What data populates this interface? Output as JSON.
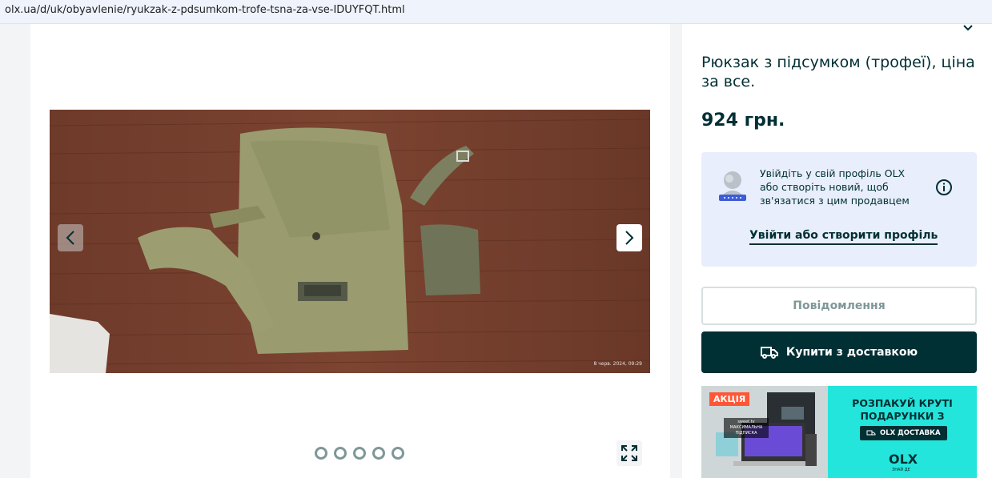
{
  "browser": {
    "url": "olx.ua/d/uk/obyavlenie/ryukzak-z-pdsumkom-trofe-tsna-za-vse-IDUYFQT.html"
  },
  "gallery": {
    "photo_caption_stamp": "8 черв. 2024, 09:29",
    "slide_count": 5,
    "icons": {
      "prev": "chevron-left-icon",
      "next": "chevron-right-icon",
      "fullscreen": "expand-icon"
    }
  },
  "listing": {
    "title": "Рюкзак з підсумком (трофеї), ціна за все.",
    "price": "924 грн."
  },
  "login_prompt": {
    "message": "Увійдіть у свій профіль OLX або створіть новий, щоб зв'язатися з цим продавцем",
    "link_label": "Увійти або створити профіль"
  },
  "actions": {
    "message_label": "Повідомлення",
    "buy_label": "Купити з доставкою"
  },
  "promo": {
    "badge": "АКЦІЯ",
    "sweet_text": "sweet.tv МАКСИМАЛЬНА ПІДПИСКА",
    "headline": "РОЗПАКУЙ КРУТІ ПОДАРУНКИ З",
    "pill": "OLX ДОСТАВКА",
    "logo": "OLX",
    "tagline": "ЗНАЙ ДЕ"
  },
  "colors": {
    "brand_dark": "#002f34",
    "promo_teal": "#23e5db",
    "promo_red": "#ff5636",
    "login_bg": "#e8eefb"
  }
}
